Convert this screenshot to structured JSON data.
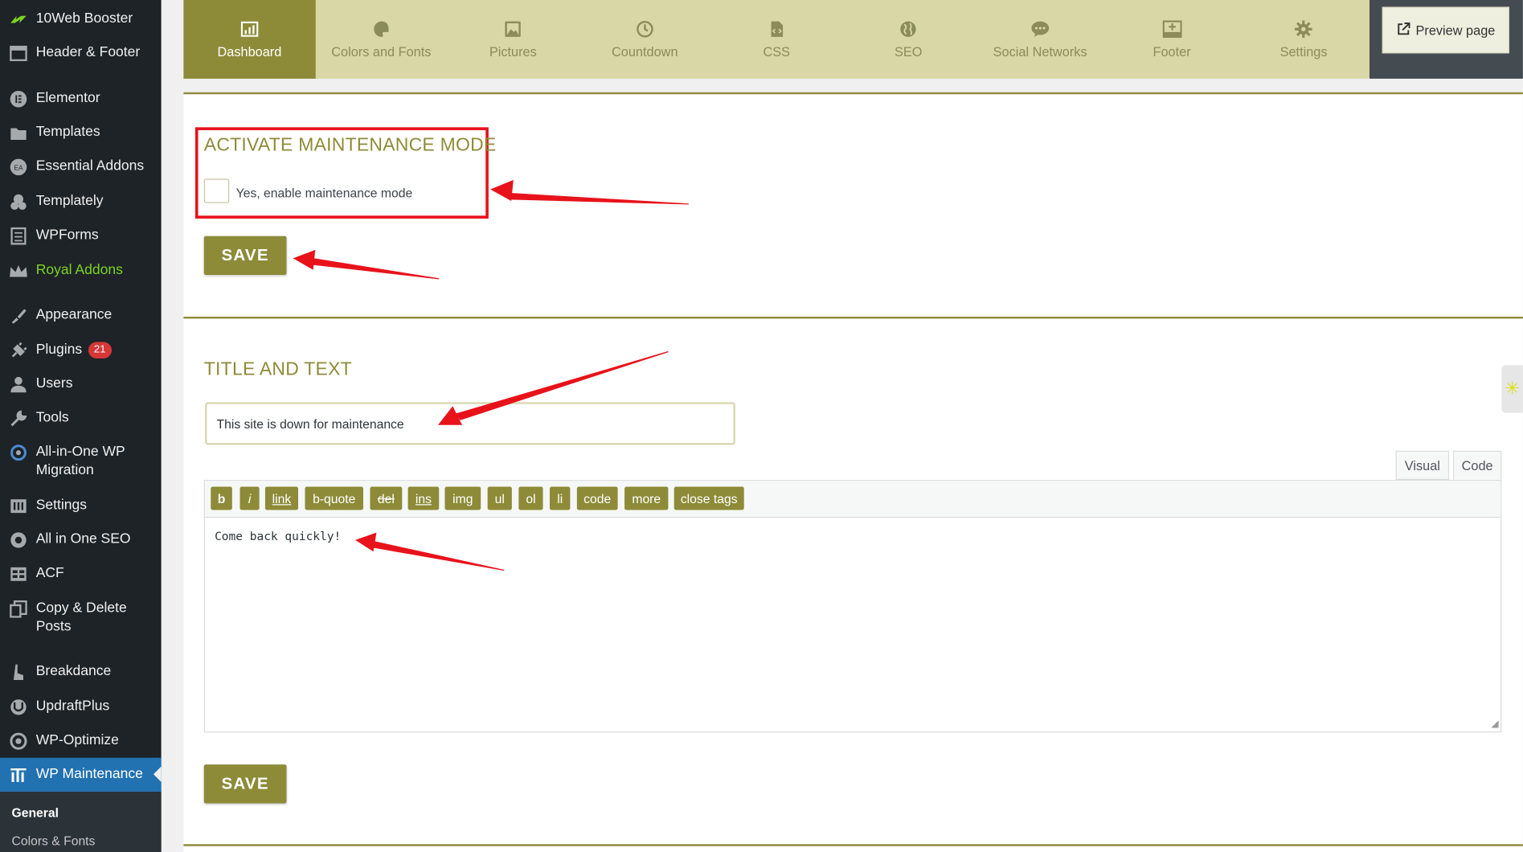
{
  "sidebar": {
    "items": [
      {
        "label": "10Web Booster",
        "icon": "10web-icon"
      },
      {
        "label": "Header & Footer",
        "icon": "header-footer-icon"
      },
      {
        "label": "Elementor",
        "icon": "elementor-icon"
      },
      {
        "label": "Templates",
        "icon": "folder-icon"
      },
      {
        "label": "Essential Addons",
        "icon": "ea-icon"
      },
      {
        "label": "Templately",
        "icon": "templately-icon"
      },
      {
        "label": "WPForms",
        "icon": "wpforms-icon"
      },
      {
        "label": "Royal Addons",
        "icon": "crown-icon"
      },
      {
        "label": "Appearance",
        "icon": "brush-icon"
      },
      {
        "label": "Plugins",
        "icon": "plug-icon",
        "badge": "21"
      },
      {
        "label": "Users",
        "icon": "user-icon"
      },
      {
        "label": "Tools",
        "icon": "wrench-icon"
      },
      {
        "label": "All-in-One WP Migration",
        "icon": "migration-icon"
      },
      {
        "label": "Settings",
        "icon": "settings-icon"
      },
      {
        "label": "All in One SEO",
        "icon": "seo-gear-icon"
      },
      {
        "label": "ACF",
        "icon": "acf-icon"
      },
      {
        "label": "Copy & Delete Posts",
        "icon": "copy-icon"
      },
      {
        "label": "Breakdance",
        "icon": "breakdance-icon"
      },
      {
        "label": "UpdraftPlus",
        "icon": "updraft-icon"
      },
      {
        "label": "WP-Optimize",
        "icon": "optimize-icon"
      },
      {
        "label": "WP Maintenance",
        "icon": "maintenance-icon"
      }
    ],
    "submenu": [
      "General",
      "Colors & Fonts"
    ]
  },
  "topnav": {
    "tabs": [
      {
        "label": "Dashboard",
        "icon": "dashboard-icon"
      },
      {
        "label": "Colors and Fonts",
        "icon": "palette-icon"
      },
      {
        "label": "Pictures",
        "icon": "pictures-icon"
      },
      {
        "label": "Countdown",
        "icon": "clock-icon"
      },
      {
        "label": "CSS",
        "icon": "css-file-icon"
      },
      {
        "label": "SEO",
        "icon": "globe-icon"
      },
      {
        "label": "Social Networks",
        "icon": "chat-icon"
      },
      {
        "label": "Footer",
        "icon": "footer-icon"
      },
      {
        "label": "Settings",
        "icon": "gear-icon"
      }
    ],
    "preview_label": "Preview page"
  },
  "activate": {
    "title": "ACTIVATE MAINTENANCE MODE",
    "checkbox_label": "Yes, enable maintenance mode",
    "checked": false,
    "save_label": "SAVE"
  },
  "title_text": {
    "title": "TITLE AND TEXT",
    "input_value": "This site is down for maintenance",
    "mode_tabs": [
      "Visual",
      "Code"
    ],
    "quicktags": [
      "b",
      "i",
      "link",
      "b-quote",
      "del",
      "ins",
      "img",
      "ul",
      "ol",
      "li",
      "code",
      "more",
      "close tags"
    ],
    "editor_content": "Come back quickly!",
    "save_label": "SAVE"
  },
  "colors": {
    "accent": "#8d8b38",
    "nav_bg": "#d9d7a6",
    "sidebar_bg": "#1d2327",
    "active_menu": "#2271b1",
    "annotation_red": "#e8121b"
  }
}
